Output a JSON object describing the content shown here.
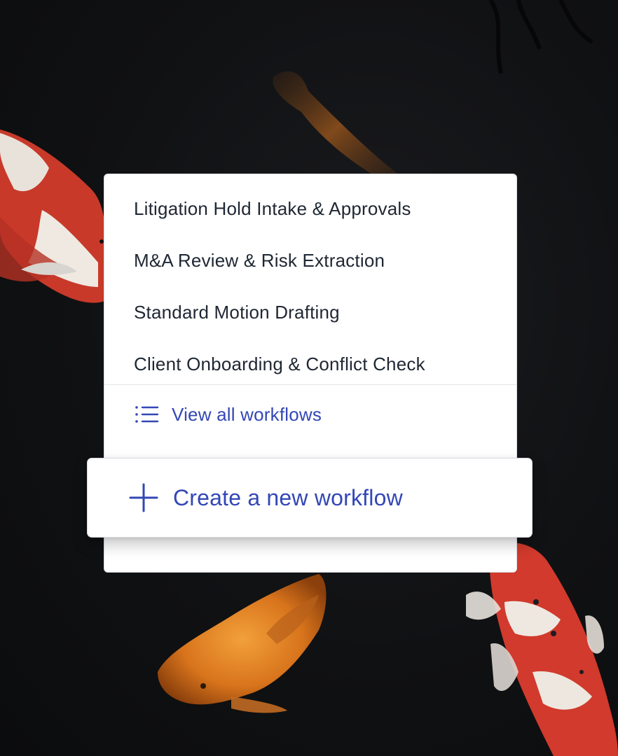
{
  "menu": {
    "items": [
      {
        "label": "Litigation Hold Intake & Approvals"
      },
      {
        "label": "M&A Review & Risk Extraction"
      },
      {
        "label": "Standard Motion Drafting"
      },
      {
        "label": "Client Onboarding & Conflict Check"
      }
    ],
    "view_all": {
      "label": "View all workflows",
      "icon": "list-icon"
    }
  },
  "create_button": {
    "label": "Create a new workflow",
    "icon": "plus-icon"
  },
  "colors": {
    "accent": "#3347b5",
    "text": "#1f2733",
    "panel_bg": "#ffffff",
    "background": "#101113"
  }
}
